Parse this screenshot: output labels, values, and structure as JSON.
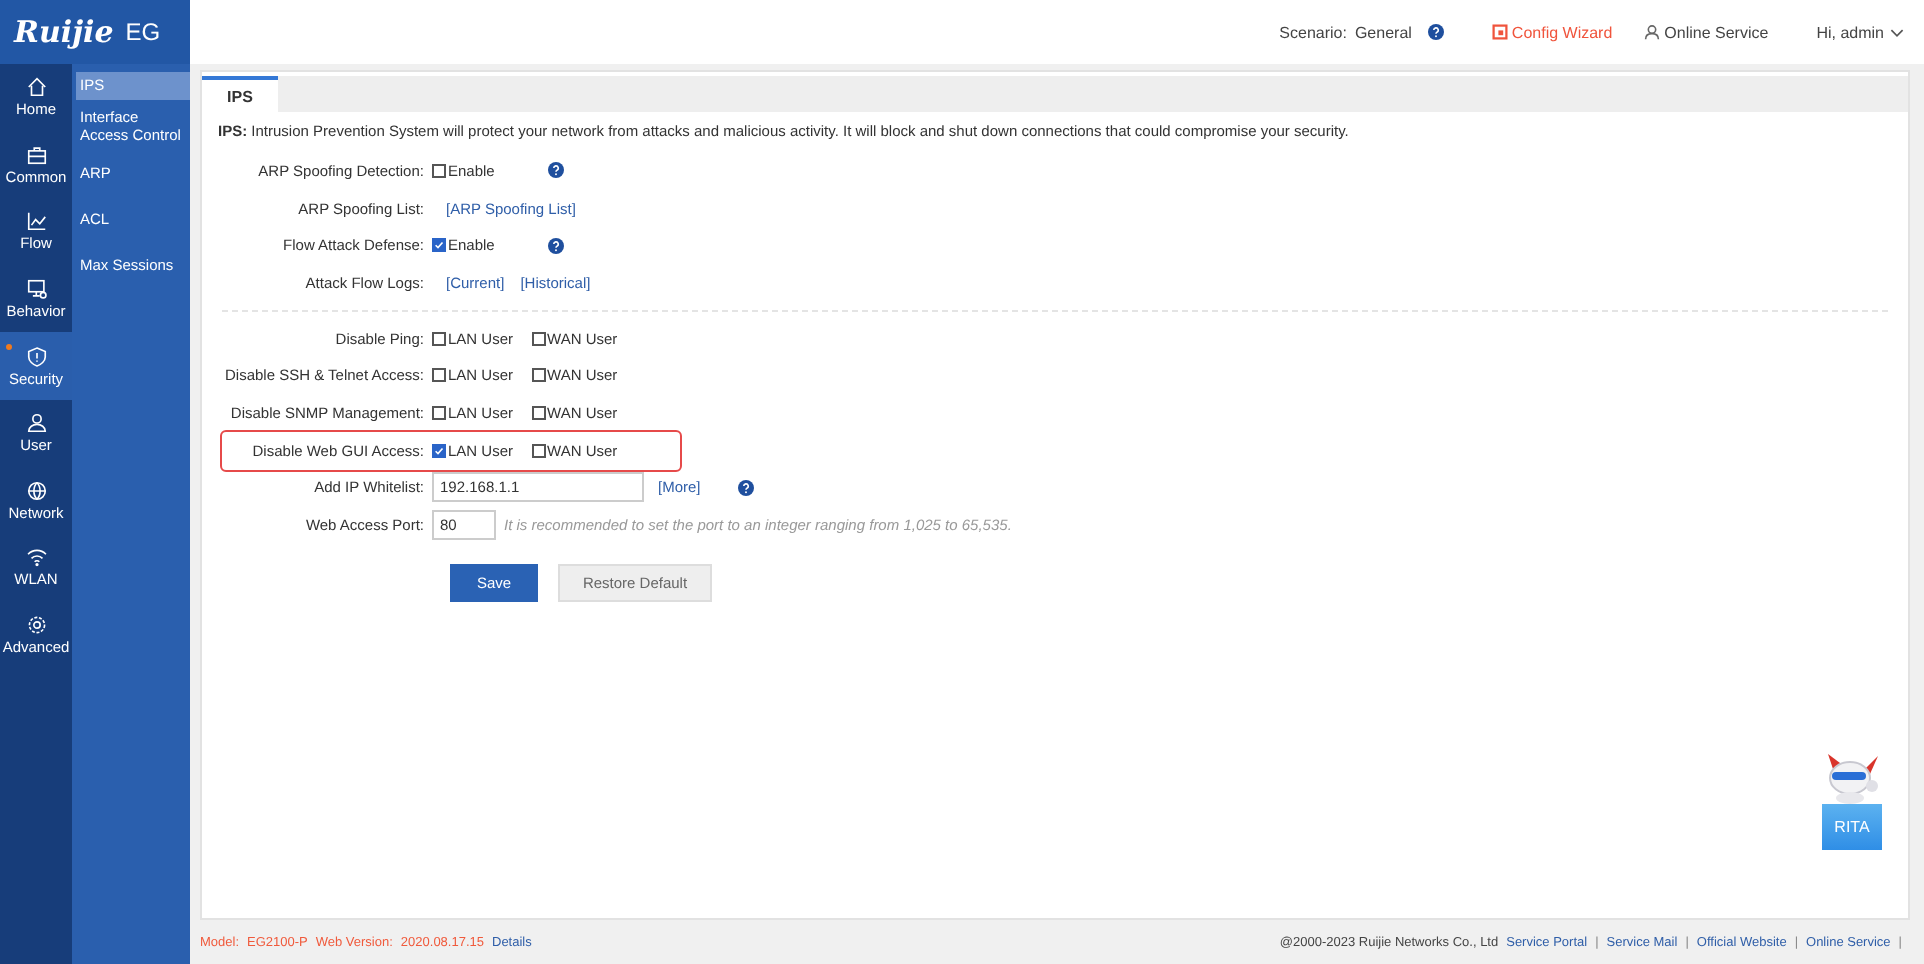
{
  "header": {
    "logo": "Ruijie",
    "product": "EG",
    "scenario_label": "Scenario:",
    "scenario": "General",
    "config_wizard": "Config Wizard",
    "online_service": "Online Service",
    "user": "Hi, admin"
  },
  "nav": [
    {
      "label": "Home",
      "selected": false,
      "alert": false
    },
    {
      "label": "Common",
      "selected": false,
      "alert": false
    },
    {
      "label": "Flow",
      "selected": false,
      "alert": false
    },
    {
      "label": "Behavior",
      "selected": false,
      "alert": false
    },
    {
      "label": "Security",
      "selected": true,
      "alert": true
    },
    {
      "label": "User",
      "selected": false,
      "alert": false
    },
    {
      "label": "Network",
      "selected": false,
      "alert": false
    },
    {
      "label": "WLAN",
      "selected": false,
      "alert": false
    },
    {
      "label": "Advanced",
      "selected": false,
      "alert": false
    }
  ],
  "submenu": [
    {
      "label": "IPS",
      "selected": true
    },
    {
      "label": "Interface Access Control",
      "selected": false
    },
    {
      "label": "ARP",
      "selected": false
    },
    {
      "label": "ACL",
      "selected": false
    },
    {
      "label": "Max Sessions",
      "selected": false
    }
  ],
  "tabs": [
    {
      "label": "IPS",
      "selected": true
    }
  ],
  "intro": "**IPS:** Intrusion Prevention System will protect your network from attacks and malicious activity. It will block and shut down connections that could compromise your security.",
  "sections": [
    {
      "rows": [
        {
          "kind": "checkbox",
          "label": "ARP Spoofing Detection:",
          "options": [
            {
              "label": "Enable",
              "checked": false
            }
          ],
          "help": true
        },
        {
          "kind": "links",
          "label": "ARP Spoofing List:",
          "links": [
            "[ARP Spoofing List]"
          ]
        },
        {
          "kind": "checkbox",
          "label": "Flow Attack Defense:",
          "options": [
            {
              "label": "Enable",
              "checked": true
            }
          ],
          "help": true
        },
        {
          "kind": "links",
          "label": "Attack Flow Logs:",
          "links": [
            "[Current]",
            "[Historical]"
          ]
        }
      ]
    },
    {
      "rows": [
        {
          "kind": "checkbox",
          "label": "Disable Ping:",
          "options": [
            {
              "label": "LAN User",
              "checked": false
            },
            {
              "label": "WAN User",
              "checked": false
            }
          ],
          "highlighted": false
        },
        {
          "kind": "checkbox",
          "label": "Disable SSH & Telnet Access:",
          "options": [
            {
              "label": "LAN User",
              "checked": false
            },
            {
              "label": "WAN User",
              "checked": false
            }
          ],
          "highlighted": false
        },
        {
          "kind": "checkbox",
          "label": "Disable SNMP Management:",
          "options": [
            {
              "label": "LAN User",
              "checked": false
            },
            {
              "label": "WAN User",
              "checked": false
            }
          ],
          "highlighted": false
        },
        {
          "kind": "checkbox",
          "label": "Disable Web GUI Access:",
          "options": [
            {
              "label": "LAN User",
              "checked": true
            },
            {
              "label": "WAN User",
              "checked": false
            }
          ],
          "highlighted": true
        },
        {
          "kind": "input",
          "label": "Add IP Whitelist:",
          "value": "192.168.1.1",
          "links": [
            "[More]"
          ],
          "help": true
        },
        {
          "kind": "input",
          "label": "Web Access Port:",
          "value": "80",
          "hint": "It is recommended to set the port to an integer ranging from 1,025 to 65,535."
        }
      ]
    }
  ],
  "buttons": [
    {
      "label": "Save",
      "kind": "primary"
    },
    {
      "label": "Restore Default",
      "kind": "secondary"
    }
  ],
  "assistant": {
    "label": "RITA"
  },
  "footer": {
    "model_label": "Model:",
    "model": "EG2100-P",
    "version_label": "Web Version:",
    "version": "2020.08.17.15",
    "details": "Details",
    "copyright": "@2000-2023 Ruijie Networks Co., Ltd",
    "links": [
      {
        "label": "Service Portal",
        "separator": "|"
      },
      {
        "label": "Service Mail",
        "separator": "|"
      },
      {
        "label": "Official Website",
        "separator": "|"
      },
      {
        "label": "Online Service",
        "separator": "|"
      }
    ]
  }
}
